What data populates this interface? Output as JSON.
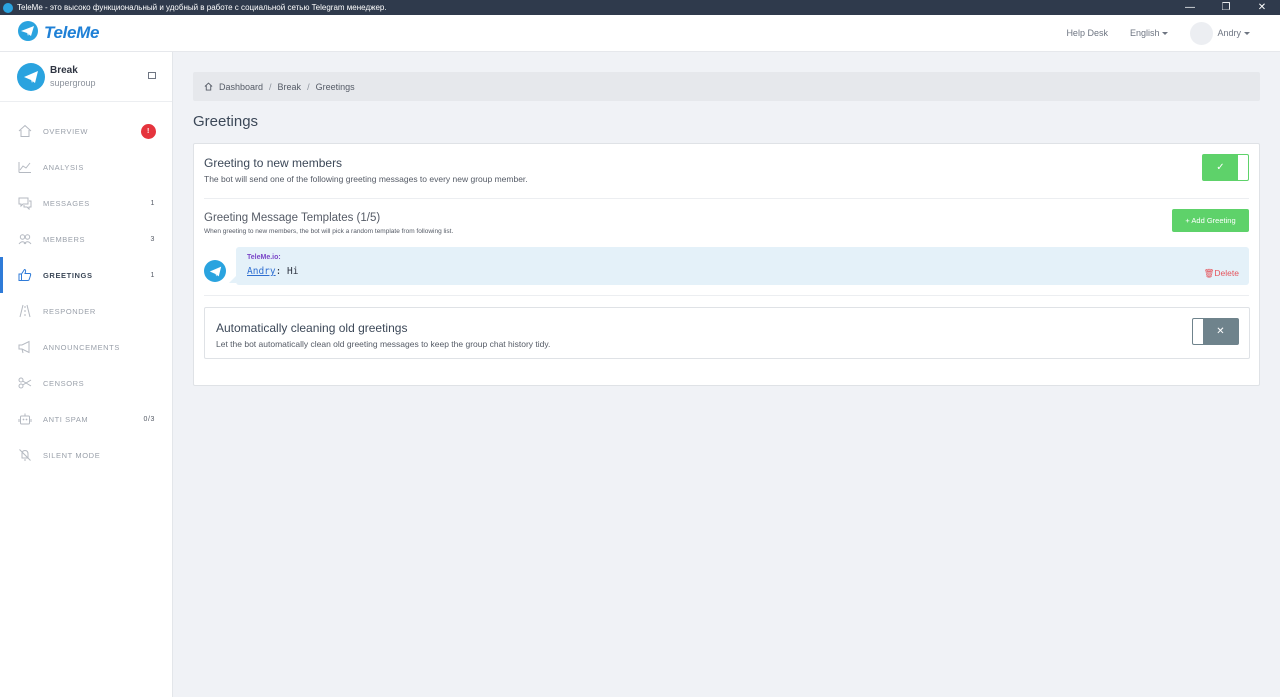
{
  "window": {
    "title": "TeleMe - это высоко функциональный и удобный в работе с социальной сетью Telegram менеджер.",
    "minimize": "—",
    "restore": "❐",
    "close": "✕"
  },
  "navbar": {
    "brand": "TeleMe",
    "help_desk": "Help Desk",
    "language": "English",
    "user": "Andry"
  },
  "sidebar": {
    "group_name": "Break",
    "group_type": "supergroup",
    "items": [
      {
        "label": "OVERVIEW",
        "badge": "!",
        "icon": "home-icon"
      },
      {
        "label": "ANALYSIS",
        "badge": "",
        "icon": "chart-icon"
      },
      {
        "label": "MESSAGES",
        "badge": "1",
        "icon": "chat-icon"
      },
      {
        "label": "MEMBERS",
        "badge": "3",
        "icon": "users-icon"
      },
      {
        "label": "GREETINGS",
        "badge": "1",
        "icon": "thumbs-up-icon"
      },
      {
        "label": "RESPONDER",
        "badge": "",
        "icon": "road-icon"
      },
      {
        "label": "ANNOUNCEMENTS",
        "badge": "",
        "icon": "megaphone-icon"
      },
      {
        "label": "CENSORS",
        "badge": "",
        "icon": "scissors-icon"
      },
      {
        "label": "ANTI SPAM",
        "badge": "0/3",
        "icon": "robot-icon"
      },
      {
        "label": "SILENT MODE",
        "badge": "",
        "icon": "mute-icon"
      }
    ],
    "active_index": 4
  },
  "breadcrumb": {
    "items": [
      "Dashboard",
      "Break",
      "Greetings"
    ],
    "separator": "/"
  },
  "page_title": "Greetings",
  "greeting_section": {
    "title": "Greeting to new members",
    "description": "The bot will send one of the following greeting messages to every new group member.",
    "enabled": true,
    "toggle_symbol": "✓"
  },
  "templates": {
    "title": "Greeting Message Templates (1/5)",
    "description": "When greeting to new members, the bot will pick a random template from following list.",
    "add_button": "+ Add Greeting",
    "messages": [
      {
        "sender": "TeleMe.io:",
        "mention": "Andry",
        "text": ": Hi",
        "delete_label": "Delete"
      }
    ]
  },
  "cleaning_section": {
    "title": "Automatically cleaning old greetings",
    "description": "Let the bot automatically clean old greeting messages to keep the group chat history tidy.",
    "enabled": false,
    "toggle_symbol": "✕"
  },
  "colors": {
    "accent": "#2f7bd8",
    "telegram": "#2aa3df",
    "success": "#5ed26a",
    "danger": "#e5343d",
    "toggle_off": "#6f838c",
    "bubble": "#e4f1f9"
  }
}
